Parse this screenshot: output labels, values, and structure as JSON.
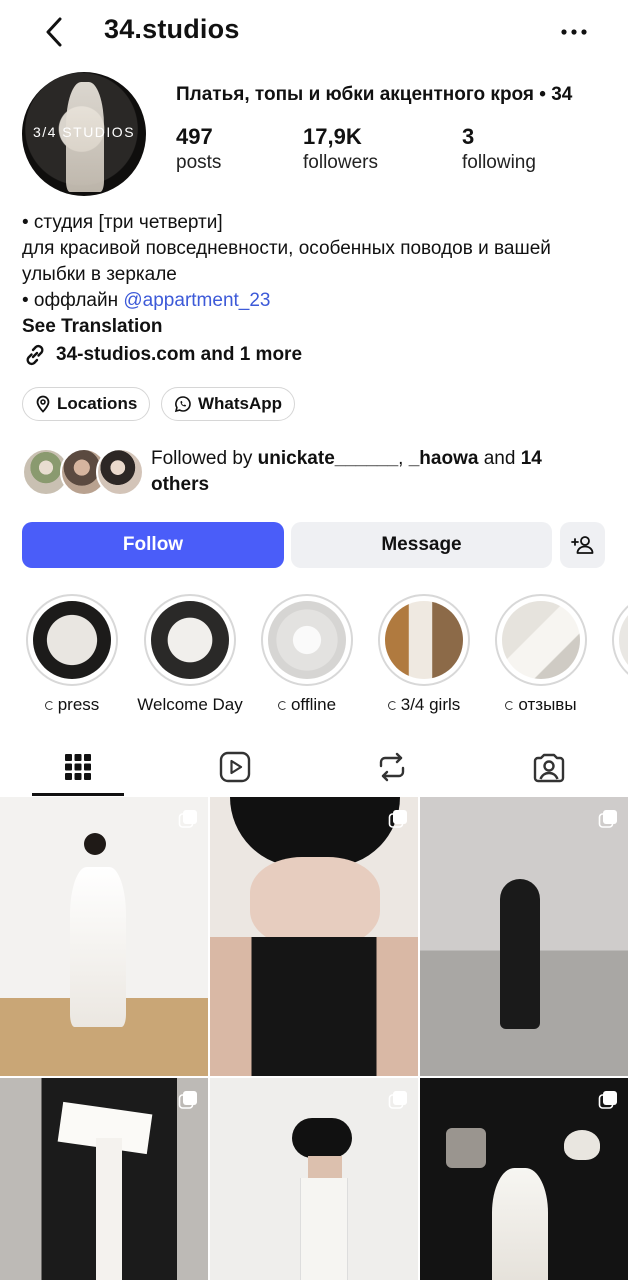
{
  "header": {
    "username": "34.studios",
    "back_icon": "chevron-left-icon",
    "more_icon": "more-horizontal-icon"
  },
  "profile": {
    "avatar_text": "3/4 STUDIOS",
    "name": "Платья, топы и юбки акцентного кроя • 34",
    "stats": [
      {
        "value": "497",
        "label": "posts"
      },
      {
        "value": "17,9K",
        "label": "followers"
      },
      {
        "value": "3",
        "label": "following"
      }
    ],
    "bio_line1": "• студия [три четверти]",
    "bio_line2": "для красивой повседневности, особенных поводов и вашей улыбки в зеркале",
    "bio_line3_prefix": "• оффлайн ",
    "bio_mention": "@appartment_23",
    "see_translation": "See Translation",
    "link_text": "34-studios.com and 1 more"
  },
  "chips": [
    {
      "label": "Locations",
      "icon": "location-pin-icon"
    },
    {
      "label": "WhatsApp",
      "icon": "whatsapp-icon"
    }
  ],
  "followed_by": {
    "prefix": "Followed by ",
    "user1": "unickate______",
    "sep": ", ",
    "user2": "_haowa",
    "and": " and ",
    "others": "14 others"
  },
  "actions": {
    "follow": "Follow",
    "message": "Message",
    "add_icon": "add-person-icon"
  },
  "highlights": [
    {
      "label": "press",
      "dot": true
    },
    {
      "label": "Welcome Day",
      "dot": false
    },
    {
      "label": "offline",
      "dot": true
    },
    {
      "label": "3/4 girls",
      "dot": true
    },
    {
      "label": "отзывы",
      "dot": true
    }
  ],
  "tabs": [
    "grid-icon",
    "reels-icon",
    "reposts-icon",
    "tagged-icon"
  ],
  "colors": {
    "follow_button": "#4a5df9",
    "mention": "#3d5ad8",
    "secondary_button": "#eff0f3"
  }
}
